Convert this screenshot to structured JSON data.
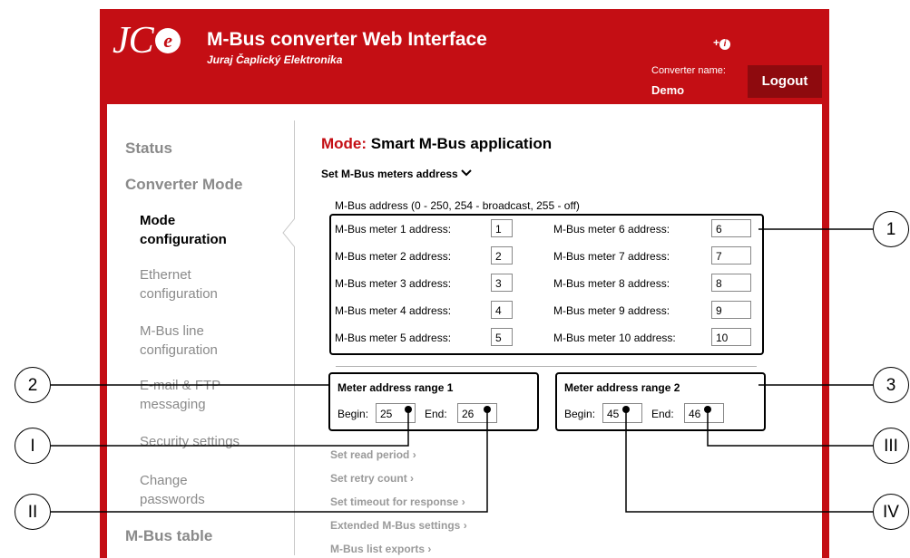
{
  "header": {
    "logo": "JC",
    "logo_e": "e",
    "title": "M-Bus converter Web Interface",
    "subtitle": "Juraj Čaplický Elektronika",
    "info": "+",
    "info_icon": "i",
    "converter_name_label": "Converter name:",
    "converter_name": "Demo",
    "logout": "Logout"
  },
  "sidebar": {
    "status": "Status",
    "converter_mode": "Converter Mode",
    "items": [
      {
        "line1": "Mode",
        "line2": "configuration"
      },
      {
        "line1": "Ethernet",
        "line2": "configuration"
      },
      {
        "line1": "M-Bus line",
        "line2": "configuration"
      },
      {
        "line1": "E-mail & FTP",
        "line2": "messaging"
      },
      {
        "line1": "Security settings",
        "line2": ""
      },
      {
        "line1": "Change",
        "line2": "passwords"
      }
    ],
    "mbus_table": "M-Bus table"
  },
  "main": {
    "mode_label": "Mode:",
    "mode_value": "Smart M-Bus application",
    "set_address": "Set M-Bus meters address",
    "address_hint": "M-Bus address (0 - 250, 254 - broadcast, 255 - off)",
    "meters": [
      {
        "label": "M-Bus meter 1 address:",
        "value": "1"
      },
      {
        "label": "M-Bus meter 2 address:",
        "value": "2"
      },
      {
        "label": "M-Bus meter 3 address:",
        "value": "3"
      },
      {
        "label": "M-Bus meter 4 address:",
        "value": "4"
      },
      {
        "label": "M-Bus meter 5 address:",
        "value": "5"
      },
      {
        "label": "M-Bus meter 6 address:",
        "value": "6"
      },
      {
        "label": "M-Bus meter 7 address:",
        "value": "7"
      },
      {
        "label": "M-Bus meter 8 address:",
        "value": "8"
      },
      {
        "label": "M-Bus meter 9 address:",
        "value": "9"
      },
      {
        "label": "M-Bus meter 10 address:",
        "value": "10"
      }
    ],
    "ranges": [
      {
        "title": "Meter address range 1",
        "begin_label": "Begin:",
        "begin": "25",
        "end_label": "End:",
        "end": "26"
      },
      {
        "title": "Meter address range 2",
        "begin_label": "Begin:",
        "begin": "45",
        "end_label": "End:",
        "end": "46"
      }
    ],
    "links": [
      "Set read period",
      "Set retry count",
      "Set timeout for response",
      "Extended M-Bus settings",
      "M-Bus list exports"
    ]
  },
  "callouts": [
    "1",
    "2",
    "3",
    "I",
    "II",
    "III",
    "IV"
  ],
  "colors": {
    "brand_red": "#c40e14",
    "logout_bg": "#8e0a0e",
    "inactive_text": "#8a8a8a"
  }
}
